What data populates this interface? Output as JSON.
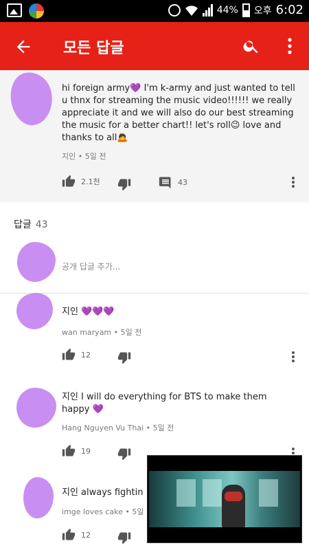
{
  "status_bar": {
    "battery": "44%",
    "ampm": "오후",
    "time": "6:02"
  },
  "header": {
    "title": "모든 답글"
  },
  "top_comment": {
    "text": "hi foreign army💜 I'm k-army and just wanted to tell u thnx for streaming the music video!!!!!! we really appreciate it and we will also do our best streaming the music for a better chart!! let's roll😉 love and thanks to all🙇",
    "author": "지인",
    "time": "5일 전",
    "likes": "2.1천",
    "replies": "43"
  },
  "replies_section": {
    "label": "답글",
    "count": "43",
    "add_placeholder": "공개 답글 추가..."
  },
  "replies": [
    {
      "text": "지인 💜💜💜",
      "author": "wan maryam",
      "time": "5일 전",
      "likes": "12"
    },
    {
      "text": "지인 I will do everything for BTS to make them happy 💜",
      "author": "Hang Nguyen Vu Thai",
      "time": "5일 전",
      "likes": "19"
    },
    {
      "text": "지인 always fightin",
      "author": "imge loves cake",
      "time": "5일 ?",
      "likes": "12"
    }
  ],
  "colors": {
    "appbar": "#e62117",
    "avatar_scribble": "#c98ef2"
  }
}
